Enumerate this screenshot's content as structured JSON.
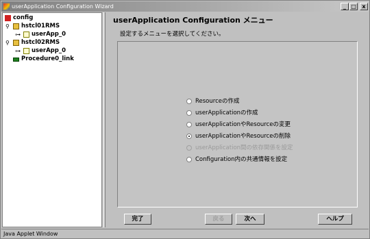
{
  "window": {
    "title": "userApplication Configuration Wizard"
  },
  "title_buttons": {
    "minimize": "_",
    "maximize": "□",
    "close": "x"
  },
  "tree": [
    {
      "label": "config",
      "icon": "config-icon",
      "handle": ""
    },
    {
      "label": "hstcl01RMS",
      "icon": "folder-icon",
      "handle": "⚲"
    },
    {
      "label": "userApp_0",
      "icon": "document-icon",
      "handle": "⊶"
    },
    {
      "label": "hstcl02RMS",
      "icon": "folder-icon",
      "handle": "⚲"
    },
    {
      "label": "userApp_0",
      "icon": "document-icon",
      "handle": "⊶"
    },
    {
      "label": "Procedure0_link",
      "icon": "link-icon",
      "handle": ""
    }
  ],
  "main": {
    "title": "userApplication Configuration メニュー",
    "subtitle": "設定するメニューを選択してください。",
    "options": [
      {
        "label": "Resourceの作成",
        "selected": false,
        "disabled": false
      },
      {
        "label": "userApplicationの作成",
        "selected": false,
        "disabled": false
      },
      {
        "label": "userApplicationやResourceの変更",
        "selected": false,
        "disabled": false
      },
      {
        "label": "userApplicationやResourceの削除",
        "selected": true,
        "disabled": false
      },
      {
        "label": "userApplication間の依存関係を設定",
        "selected": false,
        "disabled": true
      },
      {
        "label": "Configuration内の共通情報を設定",
        "selected": false,
        "disabled": false
      }
    ]
  },
  "buttons": {
    "finish": "完了",
    "back": "戻る",
    "next": "次へ",
    "help": "ヘルプ"
  },
  "status": "Java Applet Window"
}
